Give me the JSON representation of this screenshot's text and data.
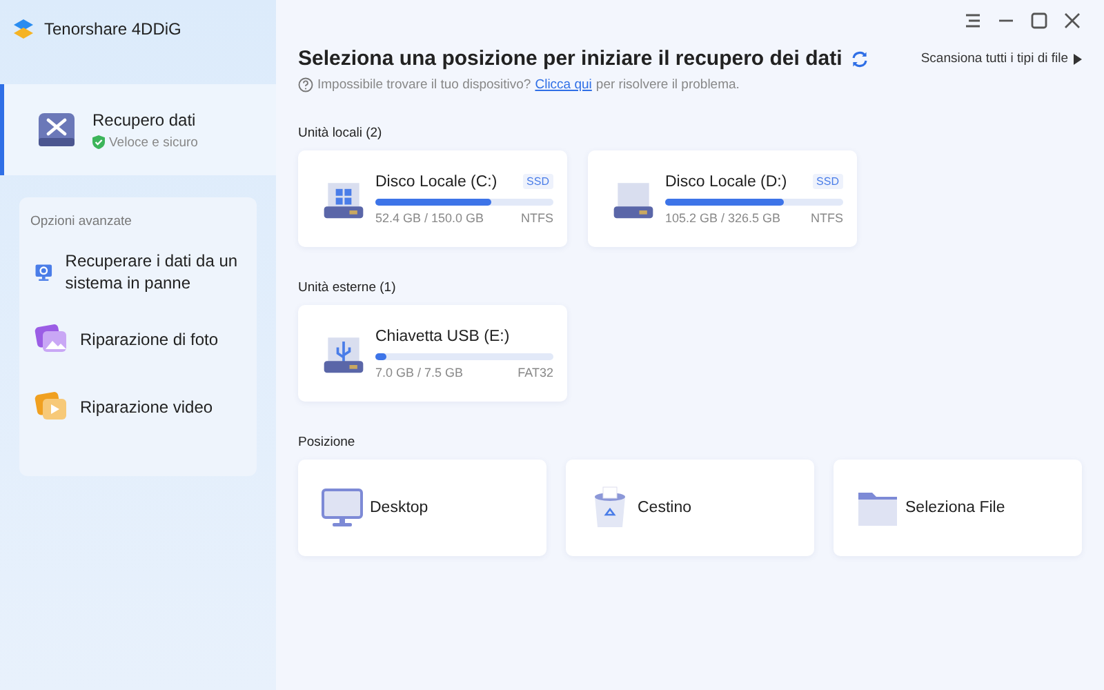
{
  "app": {
    "name": "Tenorshare 4DDiG"
  },
  "sidebar": {
    "items": [
      {
        "label": "Recupero dati",
        "subtitle": "Veloce e sicuro",
        "selected": true
      }
    ],
    "advanced": {
      "title": "Opzioni avanzate",
      "items": [
        {
          "kind": "crash",
          "label": "Recuperare i dati da un sistema in panne"
        },
        {
          "kind": "photo",
          "label": "Riparazione di foto"
        },
        {
          "kind": "video",
          "label": "Riparazione video"
        }
      ]
    }
  },
  "header": {
    "title": "Seleziona una posizione per iniziare il recupero dei dati",
    "help": "Impossibile trovare il tuo dispositivo?",
    "link": "Clicca qui",
    "help_after": "per risolvere il problema.",
    "scan_all": "Scansiona tutti i tipi di file"
  },
  "sections": [
    {
      "title": "Unità locali (2)",
      "drives": [
        {
          "kind": "windows",
          "name": "Disco Locale (C:)",
          "badge": "SSD",
          "level": 0.65,
          "size": "52.4 GB / 150.0 GB",
          "fs": "NTFS"
        },
        {
          "kind": "disk",
          "name": "Disco Locale (D:)",
          "badge": "SSD",
          "level": 0.67,
          "size": "105.2 GB / 326.5 GB",
          "fs": "NTFS"
        }
      ]
    },
    {
      "title": "Unità esterne (1)",
      "drives": [
        {
          "kind": "usb",
          "name": "Chiavetta USB (E:)",
          "level": 0.06,
          "size": "7.0 GB / 7.5 GB",
          "fs": "FAT32"
        }
      ]
    }
  ],
  "locations": {
    "title": "Posizione",
    "items": [
      {
        "kind": "desktop",
        "label": "Desktop"
      },
      {
        "kind": "trash",
        "label": "Cestino"
      },
      {
        "kind": "folder",
        "label": "Seleziona File"
      }
    ]
  }
}
